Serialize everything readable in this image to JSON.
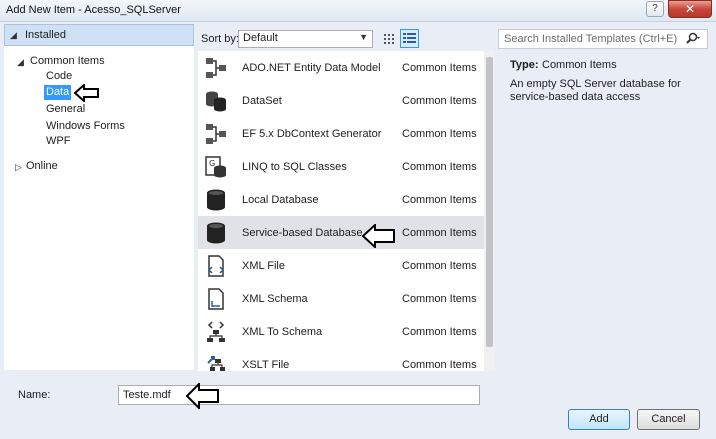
{
  "window": {
    "title": "Add New Item - Acesso_SQLServer",
    "help_label": "?",
    "close_label": "✕"
  },
  "tree": {
    "installed": "Installed",
    "common_items": "Common Items",
    "children": [
      "Code",
      "Data",
      "General",
      "Windows Forms",
      "WPF"
    ],
    "selected": "Data",
    "online": "Online"
  },
  "toolbar": {
    "sort_label": "Sort by:",
    "sort_value": "Default",
    "search_placeholder": "Search Installed Templates (Ctrl+E)"
  },
  "templates": [
    {
      "name": "ADO.NET Entity Data Model",
      "category": "Common Items",
      "icon": "entity-model-icon"
    },
    {
      "name": "DataSet",
      "category": "Common Items",
      "icon": "dataset-icon"
    },
    {
      "name": "EF 5.x DbContext Generator",
      "category": "Common Items",
      "icon": "dbcontext-generator-icon"
    },
    {
      "name": "LINQ to SQL Classes",
      "category": "Common Items",
      "icon": "linq-to-sql-icon"
    },
    {
      "name": "Local Database",
      "category": "Common Items",
      "icon": "database-icon"
    },
    {
      "name": "Service-based Database",
      "category": "Common Items",
      "icon": "database-icon",
      "selected": true
    },
    {
      "name": "XML File",
      "category": "Common Items",
      "icon": "xml-file-icon"
    },
    {
      "name": "XML Schema",
      "category": "Common Items",
      "icon": "xml-schema-icon"
    },
    {
      "name": "XML To Schema",
      "category": "Common Items",
      "icon": "xml-to-schema-icon"
    },
    {
      "name": "XSLT File",
      "category": "Common Items",
      "icon": "xslt-file-icon"
    }
  ],
  "details": {
    "type_label": "Type:",
    "type_value": "Common Items",
    "description": "An empty SQL Server database for service-based data access"
  },
  "name_field": {
    "label": "Name:",
    "value": "Teste.mdf"
  },
  "buttons": {
    "add": "Add",
    "cancel": "Cancel"
  },
  "colors": {
    "selection_blue": "#3399ff",
    "header_blue": "#cfe0f5",
    "selected_row": "#e1e1e8",
    "close_red": "#c7473a"
  }
}
